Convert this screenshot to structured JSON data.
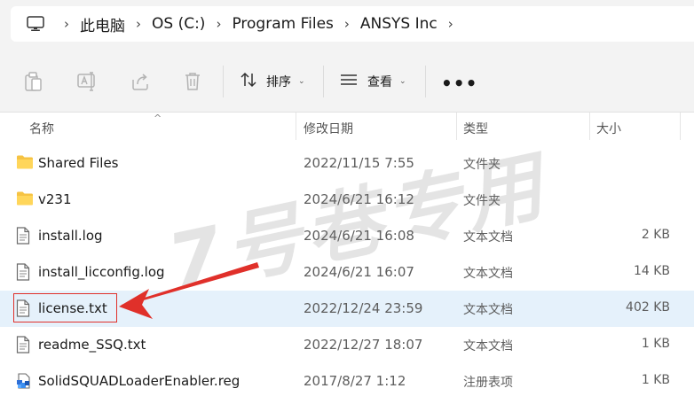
{
  "breadcrumb": {
    "items": [
      "此电脑",
      "OS (C:)",
      "Program Files",
      "ANSYS Inc"
    ],
    "separator": "›"
  },
  "toolbar": {
    "sort_label": "排序",
    "view_label": "查看",
    "more_label": "•••",
    "icons": [
      "copy-icon",
      "rename-icon",
      "share-icon",
      "delete-icon"
    ]
  },
  "columns": {
    "name": "名称",
    "modified": "修改日期",
    "type": "类型",
    "size": "大小"
  },
  "files": [
    {
      "name": "Shared Files",
      "date": "2022/11/15 7:55",
      "type": "文件夹",
      "size": "",
      "icon": "folder-icon"
    },
    {
      "name": "v231",
      "date": "2024/6/21 16:12",
      "type": "文件夹",
      "size": "",
      "icon": "folder-icon"
    },
    {
      "name": "install.log",
      "date": "2024/6/21 16:08",
      "type": "文本文档",
      "size": "2 KB",
      "icon": "text-file-icon"
    },
    {
      "name": "install_licconfig.log",
      "date": "2024/6/21 16:07",
      "type": "文本文档",
      "size": "14 KB",
      "icon": "text-file-icon"
    },
    {
      "name": "license.txt",
      "date": "2022/12/24 23:59",
      "type": "文本文档",
      "size": "402 KB",
      "icon": "text-file-icon",
      "selected": true
    },
    {
      "name": "readme_SSQ.txt",
      "date": "2022/12/27 18:07",
      "type": "文本文档",
      "size": "1 KB",
      "icon": "text-file-icon"
    },
    {
      "name": "SolidSQUADLoaderEnabler.reg",
      "date": "2017/8/27 1:12",
      "type": "注册表项",
      "size": "1 KB",
      "icon": "registry-file-icon"
    }
  ],
  "watermark": "7号巷专用",
  "colors": {
    "selected_row": "#e5f1fb",
    "annotation": "#e0302a",
    "folder": "#f6c343"
  }
}
